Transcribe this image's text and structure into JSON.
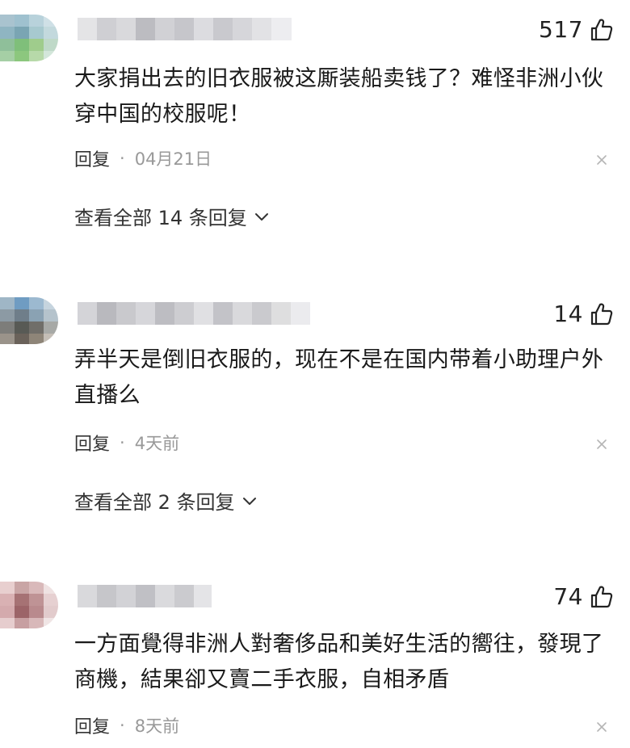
{
  "comments": [
    {
      "likes": "517",
      "text": "大家捐出去的旧衣服被这厮装船卖钱了？难怪非洲小伙穿中国的校服呢！",
      "reply_label": "回复",
      "separator": "·",
      "time": "04月21日",
      "view_all": "查看全部 14 条回复"
    },
    {
      "likes": "14",
      "text": "弄半天是倒旧衣服的，现在不是在国内带着小助理户外直播么",
      "reply_label": "回复",
      "separator": "·",
      "time": "4天前",
      "view_all": "查看全部 2 条回复"
    },
    {
      "likes": "74",
      "text": "一方面覺得非洲人對奢侈品和美好生活的嚮往，發現了商機，結果卻又賣二手衣服，自相矛盾",
      "reply_label": "回复",
      "separator": "·",
      "time": "8天前"
    }
  ],
  "icons": {
    "like": "thumbs-up-icon",
    "close": "close-icon",
    "expand": "chevron-down-icon"
  },
  "colors": {
    "text": "#1a1a1a",
    "meta": "#999999",
    "action": "#333333"
  }
}
